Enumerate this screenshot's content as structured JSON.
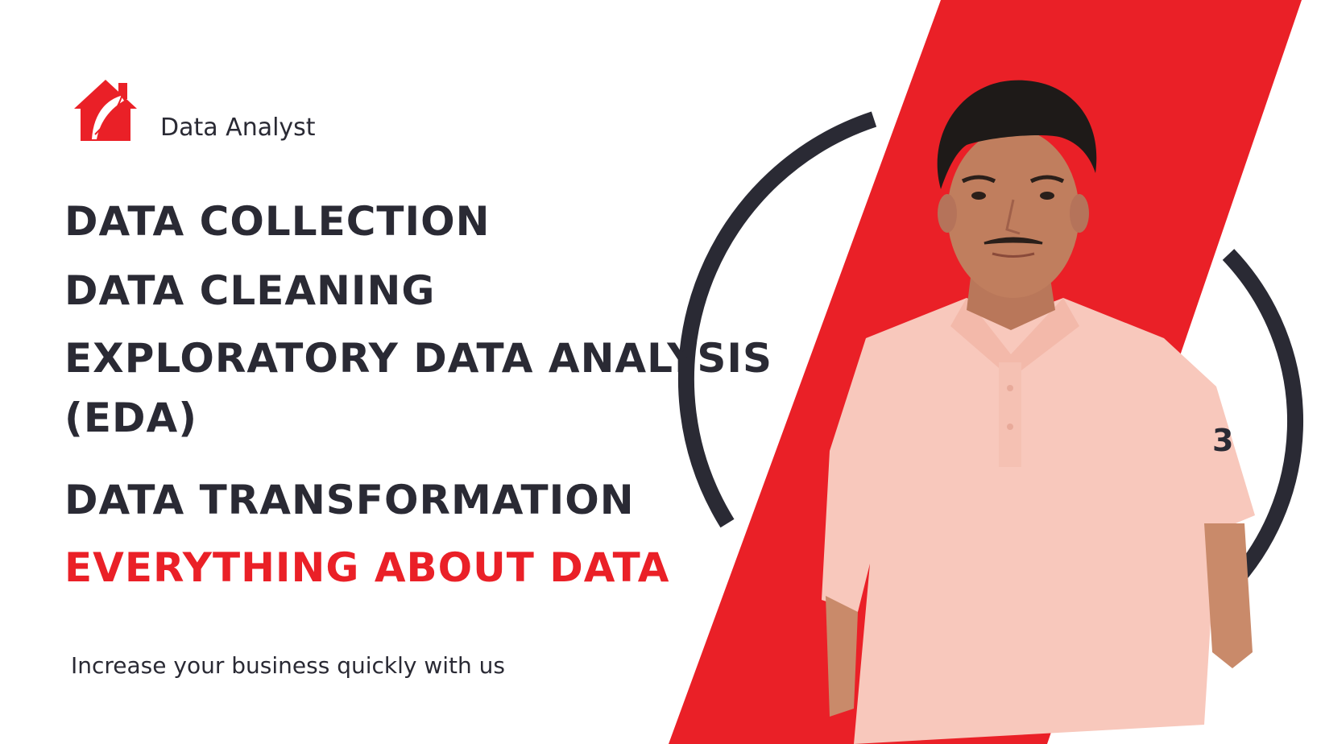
{
  "brand": {
    "name": "Data Analyst",
    "logo_icon": "house-feather-icon"
  },
  "services": [
    "DATA COLLECTION",
    "DATA CLEANING",
    "EXPLORATORY DATA ANALYSIS",
    "(EDA)",
    "DATA TRANSFORMATION"
  ],
  "highlight": "EVERYTHING ABOUT DATA",
  "tagline": "Increase your business quickly with us",
  "colors": {
    "accent": "#EA2027",
    "text": "#2A2A34",
    "ring": "#2A2A34",
    "shirt": "#F8C8BC",
    "background": "#FFFFFF"
  },
  "photo": {
    "subject": "person-portrait"
  }
}
